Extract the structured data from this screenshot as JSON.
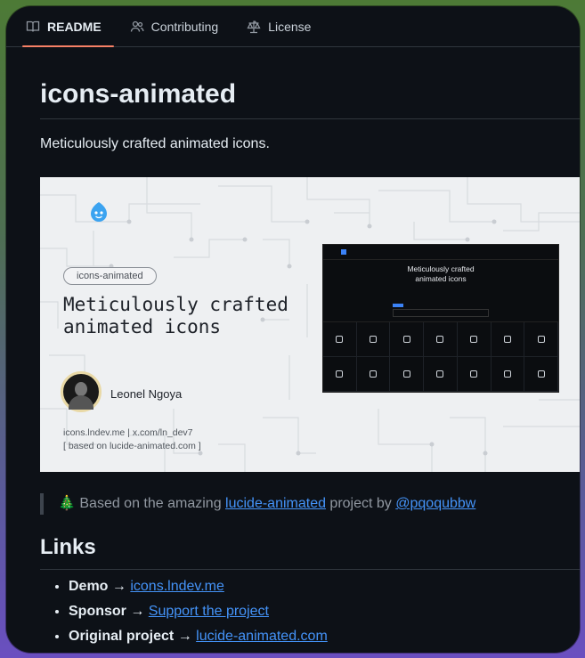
{
  "tabs": [
    {
      "label": "README",
      "icon": "book-icon",
      "active": true
    },
    {
      "label": "Contributing",
      "icon": "people-icon",
      "active": false
    },
    {
      "label": "License",
      "icon": "law-icon",
      "active": false
    }
  ],
  "readme": {
    "title": "icons-animated",
    "description": "Meticulously crafted animated icons.",
    "banner": {
      "pill": "icons-animated",
      "headline_line1": "Meticulously crafted",
      "headline_line2": "animated icons",
      "author": "Leonel Ngoya",
      "links_line": "icons.lndev.me | x.com/ln_dev7",
      "based_line": "[ based on lucide-animated.com ]",
      "preview_title_line1": "Meticulously crafted",
      "preview_title_line2": "animated icons"
    },
    "quote": {
      "emoji": "🎄",
      "prefix": " Based on the amazing ",
      "link1": "lucide-animated",
      "middle": " project by ",
      "link2": "@pqoqubbw"
    },
    "links_heading": "Links",
    "links": [
      {
        "label": "Demo",
        "arrow": " → ",
        "link": "icons.lndev.me"
      },
      {
        "label": "Sponsor",
        "arrow": " → ",
        "link": "Support the project"
      },
      {
        "label": "Original project",
        "arrow": " → ",
        "link": "lucide-animated.com"
      }
    ]
  },
  "colors": {
    "accent_tab": "#f78166",
    "link": "#4493f8",
    "background": "#0d1117"
  }
}
